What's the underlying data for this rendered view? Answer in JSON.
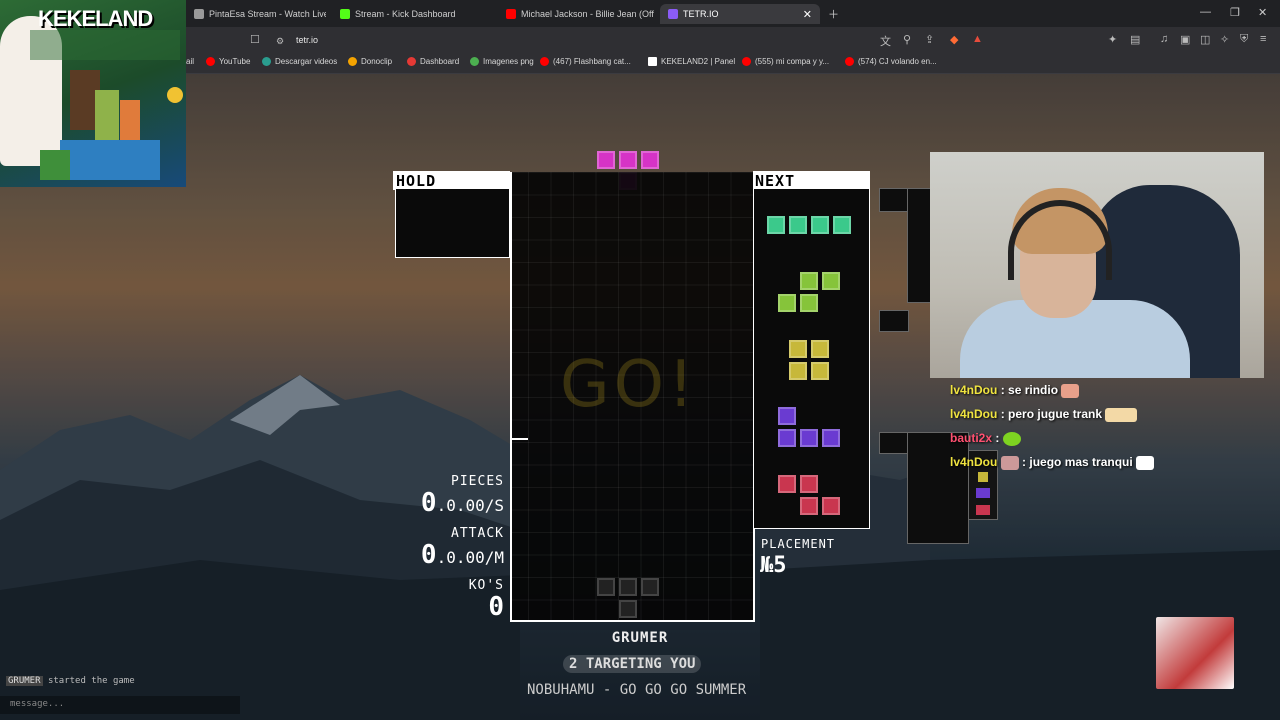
{
  "browser": {
    "tabs": [
      {
        "label": "PintaEsa Stream - Watch Live on",
        "icon_color": "#9a9a9a"
      },
      {
        "label": "Stream - Kick Dashboard",
        "icon_color": "#53fc18"
      },
      {
        "label": "Michael Jackson - Billie Jean (Official",
        "icon_color": "#ff0000"
      },
      {
        "label": "TETR.IO",
        "icon_color": "#8b5cf6"
      }
    ],
    "url": "tetr.io",
    "bookmarks": [
      {
        "label": "ail",
        "color": "#ea4335"
      },
      {
        "label": "YouTube",
        "color": "#ff0000"
      },
      {
        "label": "Descargar videos",
        "color": "#2a9d8f"
      },
      {
        "label": "Donoclip",
        "color": "#f4a300"
      },
      {
        "label": "Dashboard",
        "color": "#e53935"
      },
      {
        "label": "Imagenes png",
        "color": "#4caf50"
      },
      {
        "label": "(467) Flashbang cat...",
        "color": "#ff0000"
      },
      {
        "label": "KEKELAND2 | Panel",
        "color": "#ffffff"
      },
      {
        "label": "(555) mi compa y y...",
        "color": "#ff0000"
      },
      {
        "label": "(574) CJ volando en...",
        "color": "#ff0000"
      }
    ]
  },
  "overlay": {
    "logo_text": "KEKELAND"
  },
  "game": {
    "hold_label": "HOLD",
    "next_label": "NEXT",
    "go_text": "GO!",
    "stats": {
      "pieces_label": "PIECES",
      "pieces_value": "0",
      "pieces_rate": ".0.00/S",
      "attack_label": "ATTACK",
      "attack_value": "0",
      "attack_rate": ".0.00/M",
      "kos_label": "KO'S",
      "kos_value": "0"
    },
    "placement_label": "PLACEMENT",
    "placement_value": "№5",
    "player_name": "GRUMER",
    "targeting": "2 TARGETING YOU",
    "song": "NOBUHAMU - GO GO GO SUMMER",
    "colors": {
      "T": "#d633c6",
      "I": "#3bc98b",
      "S": "#86c43a",
      "O": "#c7b83a",
      "J": "#6a3bd1",
      "Z": "#c9364f"
    }
  },
  "chat": [
    {
      "user": "lv4nDou",
      "message": ": se rindio",
      "user_color": "#f0e440"
    },
    {
      "user": "lv4nDou",
      "message": ": pero jugue trank",
      "user_color": "#f0e440"
    },
    {
      "user": "bauti2x",
      "message": ":",
      "user_color": "#ff5070"
    },
    {
      "user": "lv4nDou",
      "message": ": juego mas tranqui",
      "user_color": "#f0e440"
    }
  ],
  "room": {
    "log_line": "started the game",
    "log_user": "GRUMER",
    "message_placeholder": "message..."
  }
}
